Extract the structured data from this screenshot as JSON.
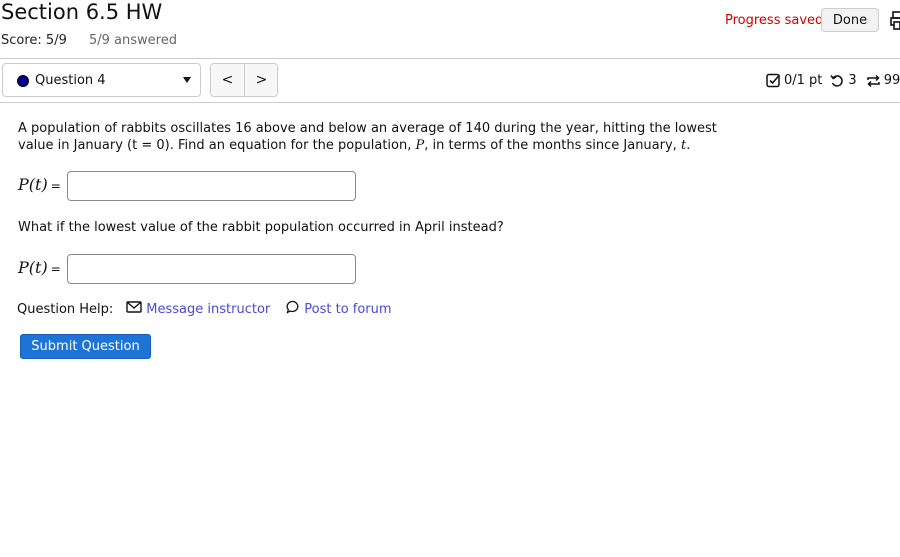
{
  "header": {
    "title": "Section 6.5 HW",
    "score": "Score: 5/9",
    "answered": "5/9 answered",
    "progress_status": "Progress saved",
    "done_label": "Done",
    "print_icon": "print-icon"
  },
  "question_nav": {
    "selected": "Question 4",
    "status_color": "#00008b",
    "prev_label": "<",
    "next_label": ">"
  },
  "question_meta": {
    "points": "0/1 pt",
    "retries": "3",
    "attempts": "99"
  },
  "question": {
    "text_part1": "A population of rabbits oscillates 16 above and below an average of 140 during the year, hitting the lowest value in January (t = 0). Find an equation for the population, ",
    "var_P": "P",
    "text_part2": ", in terms of the months since January, ",
    "var_t": "t",
    "text_part3": ".",
    "answer_label": "P(t)",
    "equals": "=",
    "answer1_value": "",
    "followup": "What if the lowest value of the rabbit population occurred in April instead?",
    "answer2_value": ""
  },
  "help": {
    "label": "Question Help:",
    "message_instructor": "Message instructor",
    "post_to_forum": "Post to forum"
  },
  "submit_label": "Submit Question",
  "colors": {
    "accent": "#1e73d6",
    "link": "#4a4ad6",
    "progress": "#cc0000"
  }
}
